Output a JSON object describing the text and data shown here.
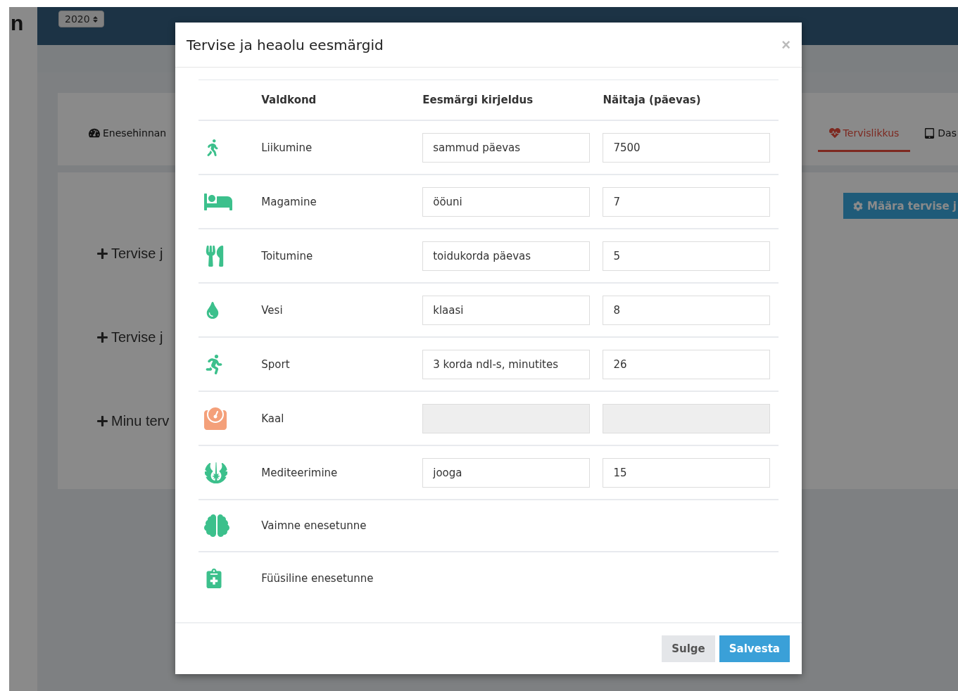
{
  "sidebar": {
    "logo": "n"
  },
  "topbar": {
    "year_select": "2020"
  },
  "tabs": [
    {
      "label": "Enesehinnan",
      "selected": false
    },
    {
      "label": "Tervislikkus",
      "selected": true
    },
    {
      "label": "Das",
      "selected": false
    }
  ],
  "actions": [
    "Tervise j",
    "Tervise j",
    "Minu terv"
  ],
  "primary_button": "Määra tervise j",
  "modal": {
    "title": "Tervise ja heaolu eesmärgid",
    "close": "×",
    "columns": [
      "Valdkond",
      "Eesmärgi kirjeldus",
      "Näitaja (päevas)"
    ],
    "rows": [
      {
        "kind": "goal",
        "area": "Liikumine",
        "description": "sammud päevas",
        "target": "7500",
        "disabled": false
      },
      {
        "kind": "goal",
        "area": "Magamine",
        "description": "ööuni",
        "target": "7",
        "disabled": false
      },
      {
        "kind": "goal",
        "area": "Toitumine",
        "description": "toidukorda päevas",
        "target": "5",
        "disabled": false
      },
      {
        "kind": "goal",
        "area": "Vesi",
        "description": "klaasi",
        "target": "8",
        "disabled": false
      },
      {
        "kind": "goal",
        "area": "Sport",
        "description": "3 korda ndl-s, minutites",
        "target": "26",
        "disabled": false
      },
      {
        "kind": "goal",
        "area": "Kaal",
        "disabled": true
      },
      {
        "kind": "goal",
        "area": "Mediteerimine",
        "description": "jooga",
        "target": "15",
        "disabled": false
      },
      {
        "kind": "plain",
        "area": "Vaimne enesetunne"
      },
      {
        "kind": "plain",
        "area": "Füüsiline enesetunne"
      }
    ],
    "buttons": [
      {
        "label": "Sulge",
        "primary": false
      },
      {
        "label": "Salvesta",
        "primary": true
      }
    ]
  }
}
